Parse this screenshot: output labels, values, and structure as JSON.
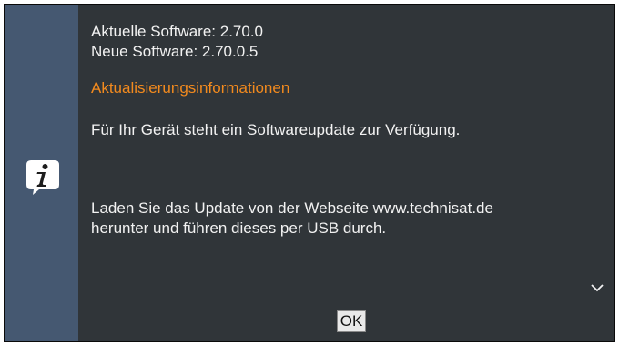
{
  "dialog": {
    "current_software": "Aktuelle Software: 2.70.0",
    "new_software": "Neue Software: 2.70.0.5",
    "update_heading": "Aktualisierungsinformationen",
    "message_1": "Für Ihr Gerät steht ein Softwareupdate zur Verfügung.",
    "message_2_line1": "Laden Sie das Update von der Webseite www.technisat.de",
    "message_2_line2": "herunter und führen dieses per USB durch.",
    "ok_label": "OK",
    "side_icon": "info-icon",
    "scroll_icon": "chevron-down-icon"
  },
  "colors": {
    "background": "#303539",
    "sidebar": "#455871",
    "heading": "#f28a1e",
    "text": "#f2f2f2"
  }
}
